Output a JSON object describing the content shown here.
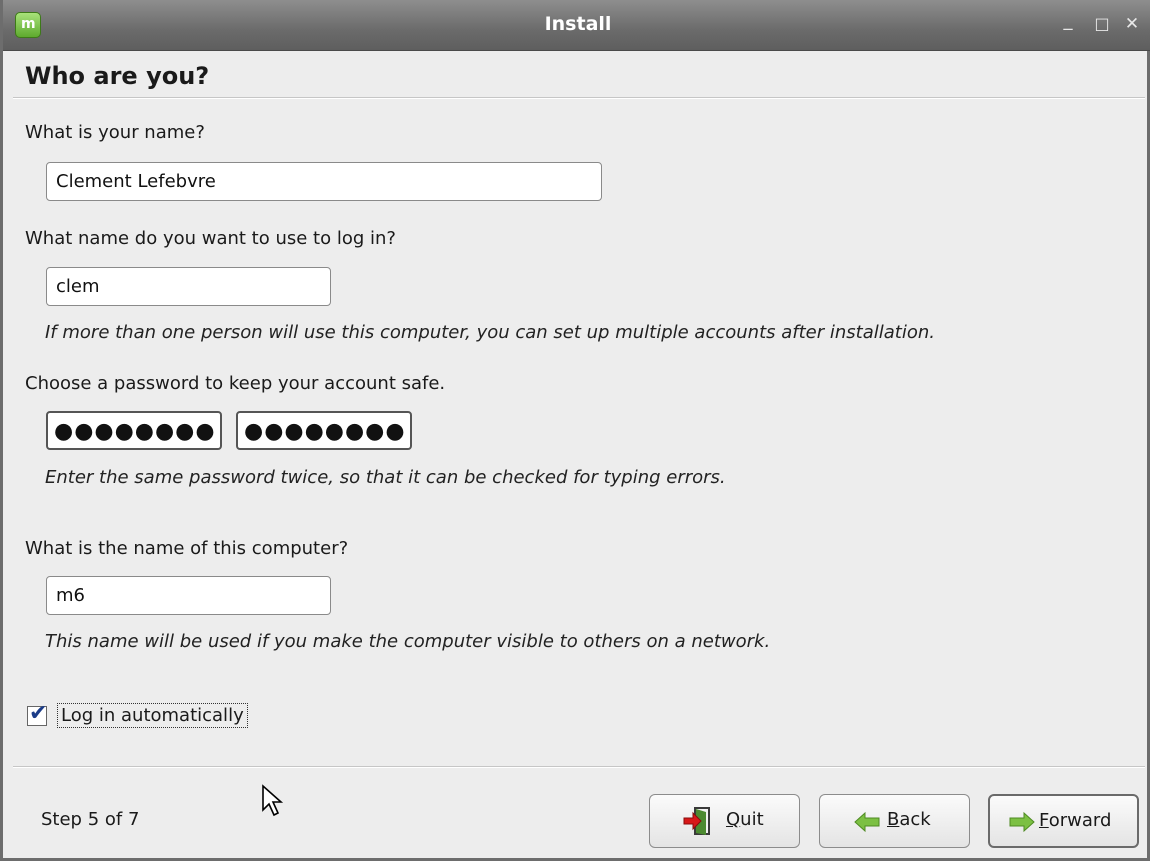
{
  "window": {
    "title": "Install",
    "app_icon": "mint-logo-icon",
    "app_icon_text": "m",
    "minimize_glyph": "_",
    "maximize_glyph": "□",
    "close_glyph": "✕"
  },
  "page": {
    "heading": "Who are you?"
  },
  "form": {
    "name_label": "What is your name?",
    "name_value": "Clement Lefebvre",
    "login_label": "What name do you want to use to log in?",
    "login_value": "clem",
    "login_hint": "If more than one person will use this computer, you can set up multiple accounts after installation.",
    "password_label": "Choose a password to keep your account safe.",
    "password_value": "●●●●●●●●",
    "password_confirm_value": "●●●●●●●●",
    "password_hint": "Enter the same password twice, so that it can be checked for typing errors.",
    "hostname_label": "What is the name of this computer?",
    "hostname_value": "m6",
    "hostname_hint": "This name will be used if you make the computer visible to others on a network.",
    "autologin_label": "Log in automatically",
    "autologin_checked": true
  },
  "footer": {
    "step_text": "Step 5 of 7",
    "quit_label": "Quit",
    "quit_mnemonic": "Q",
    "back_label": "Back",
    "back_mnemonic": "B",
    "forward_label": "Forward",
    "forward_mnemonic": "F"
  },
  "colors": {
    "titlebar": "#6b6b6b",
    "mint_green": "#5eaa2e",
    "quit_red": "#d81818",
    "arrow_green": "#7cc043"
  }
}
